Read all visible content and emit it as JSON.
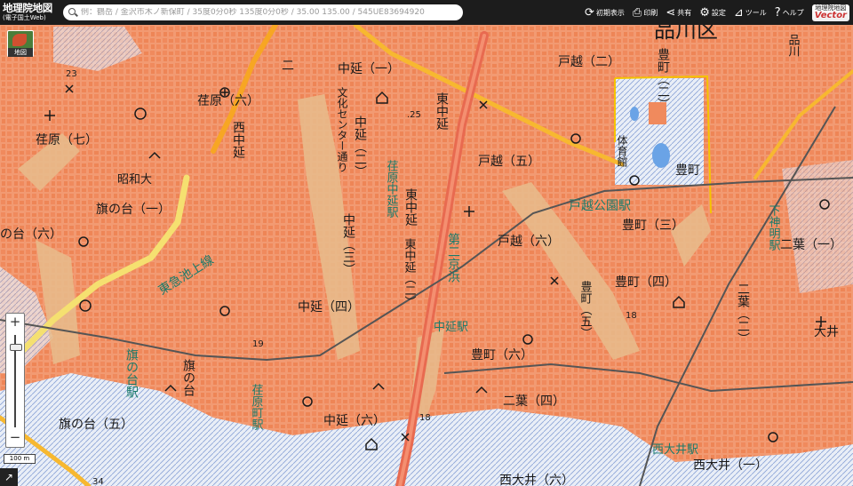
{
  "header": {
    "logo_title": "地理院地図",
    "logo_subtitle": "(電子国土Web)",
    "search_placeholder": "例：鶴岳 / 金沢市木ノ新保町 / 35度0分0秒 135度0分0秒 / 35.00 135.00 / 545UE83694920"
  },
  "toolbar": {
    "reset_label": "初期表示",
    "print_label": "印刷",
    "share_label": "共有",
    "settings_label": "設定",
    "tools_label": "ツール",
    "help_label": "ヘルプ",
    "vector_top": "地理院地図",
    "vector_bottom": "Vector"
  },
  "map": {
    "layer_button_label": "地図",
    "scale_label": "100 m",
    "labels": {
      "ebara6": "荏原（六）",
      "ebara7": "荏原（七）",
      "showa": "昭和大",
      "hatanodai1": "旗の台（一）",
      "hatanodai6": "の台（六）",
      "hatanodai_st": "旗の台駅",
      "hatanodai_area": "旗の台",
      "hatanodai5": "旗の台（五）",
      "nishinakanobu": "西中延",
      "nishinakanobu2": "二",
      "bunka": "文化センター通り",
      "nakanobu1": "中延（一）",
      "nakanobu2": "中延（二）",
      "nakanobu3": "中延（三）",
      "nakanobu4": "中延（四）",
      "nakanobu6": "中延（六）",
      "nakanobu_st": "中延駅",
      "ebaranakanobu_st": "荏原中延駅",
      "higashinakanobu": "東中延",
      "higashinakanobu1": "東中延",
      "higashinakanobu2": "東中延（二）",
      "daikeihin": "第二京浜",
      "togoshi2": "戸越（二）",
      "togoshi5": "戸越（五）",
      "togoshi6": "戸越（六）",
      "togoshikoen_st": "戸越公園駅",
      "toyomachi": "豊町",
      "toyomachi2": "豊町（二）",
      "toyomachi3": "豊町（三）",
      "toyomachi4": "豊町（四）",
      "toyomachi5": "豊町（五）",
      "toyomachi6": "豊町（六）",
      "shinagawaku": "品川区",
      "shinagawa": "品川",
      "taiikukan": "体育館",
      "shimoshinmei_st": "下神明駅",
      "futaba1": "二葉（一）",
      "futaba2": "二葉（二）",
      "futaba4": "二葉（四）",
      "oi": "大井",
      "nishioi_st": "西大井駅",
      "nishioi1": "西大井（一）",
      "nishioi6": "西大井（六）",
      "ebaramachi_st": "荏原町駅",
      "tokyu_ikegami": "東急池上線",
      "elev_23": "23",
      "elev_25": ".25",
      "elev_18a": "18",
      "elev_18b": "18",
      "elev_19": "19",
      "elev_34": "34"
    }
  }
}
